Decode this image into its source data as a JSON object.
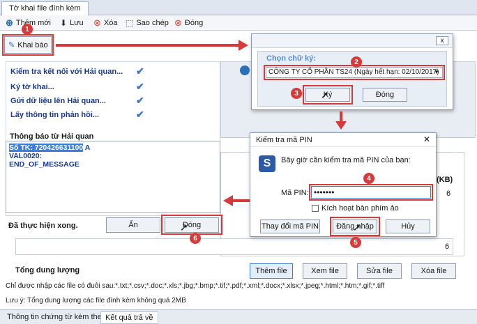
{
  "tabbar": {
    "title": "Tờ khai file đính kèm"
  },
  "toolbar": {
    "items": [
      {
        "label": "Thêm mới",
        "icon": "plus-icon"
      },
      {
        "label": "Lưu",
        "icon": "save-icon"
      },
      {
        "label": "Xóa",
        "icon": "delete-icon"
      },
      {
        "label": "Sao chép",
        "icon": "copy-icon"
      },
      {
        "label": "Đóng",
        "icon": "close-icon"
      }
    ]
  },
  "khai_bao": {
    "label": "Khai báo"
  },
  "steps": [
    {
      "label": "Kiểm tra kết nối với Hải quan..."
    },
    {
      "label": "Ký tờ khai..."
    },
    {
      "label": "Gửi dữ liệu lên Hải quan..."
    },
    {
      "label": "Lấy thông tin phản hồi..."
    }
  ],
  "messages": {
    "title": "Thông báo từ Hải quan",
    "line1_highlight": "Số TK: 720426631100",
    "line1_suffix": " A",
    "line2": "VAL0020:",
    "line3": "END_OF_MESSAGE"
  },
  "done": {
    "label": "Đã thực hiện xong.",
    "hide_button": "Ẩn",
    "close_button": "Đóng"
  },
  "signature_dialog": {
    "close": "x",
    "label": "Chọn chữ ký:",
    "selected": "CÔNG TY CỔ PHẦN TS24 (Ngày hết hạn: 02/10/2017)",
    "ok_button": "Ký",
    "close_button": "Đóng"
  },
  "pin_dialog": {
    "title": "Kiểm tra mã PIN",
    "close": "✕",
    "prompt": "Bây giờ cần kiểm tra mã PIN của bạn:",
    "pin_label": "Mã PIN:",
    "pin_value": "•••••••",
    "virtual_keyboard": "Kích hoạt bàn phím ảo",
    "change_button": "Thay đổi mã PIN",
    "login_button": "Đăng nhập",
    "cancel_button": "Hủy"
  },
  "background_panel": {
    "kb_header": "(KB)",
    "val1": "6",
    "val2": "6"
  },
  "files": {
    "total_label": "Tổng dung lượng",
    "add": "Thêm file",
    "view": "Xem file",
    "edit": "Sửa file",
    "delete": "Xóa file",
    "allowed": "Chỉ được nhập các file có đuôi sau:*.txt;*.csv;*.doc;*.xls;*.jbg;*.bmp;*.tif;*.pdf;*.xml;*.docx;*.xlsx;*.jpeg;*.html;*.htm;*.gif;*.tiff",
    "note": "Lưu ý: Tổng dung lượng các file đính kèm không quá 2MB"
  },
  "bottom_tabs": [
    {
      "label": "Thông tin chứng từ kèm theo"
    },
    {
      "label": "Kết quả trả về"
    }
  ],
  "callouts": [
    "1",
    "2",
    "3",
    "4",
    "5",
    "6"
  ],
  "colors": {
    "accent_red": "#d63a3a",
    "step_blue": "#1b3a8c",
    "highlight": "#3d7fd6"
  }
}
